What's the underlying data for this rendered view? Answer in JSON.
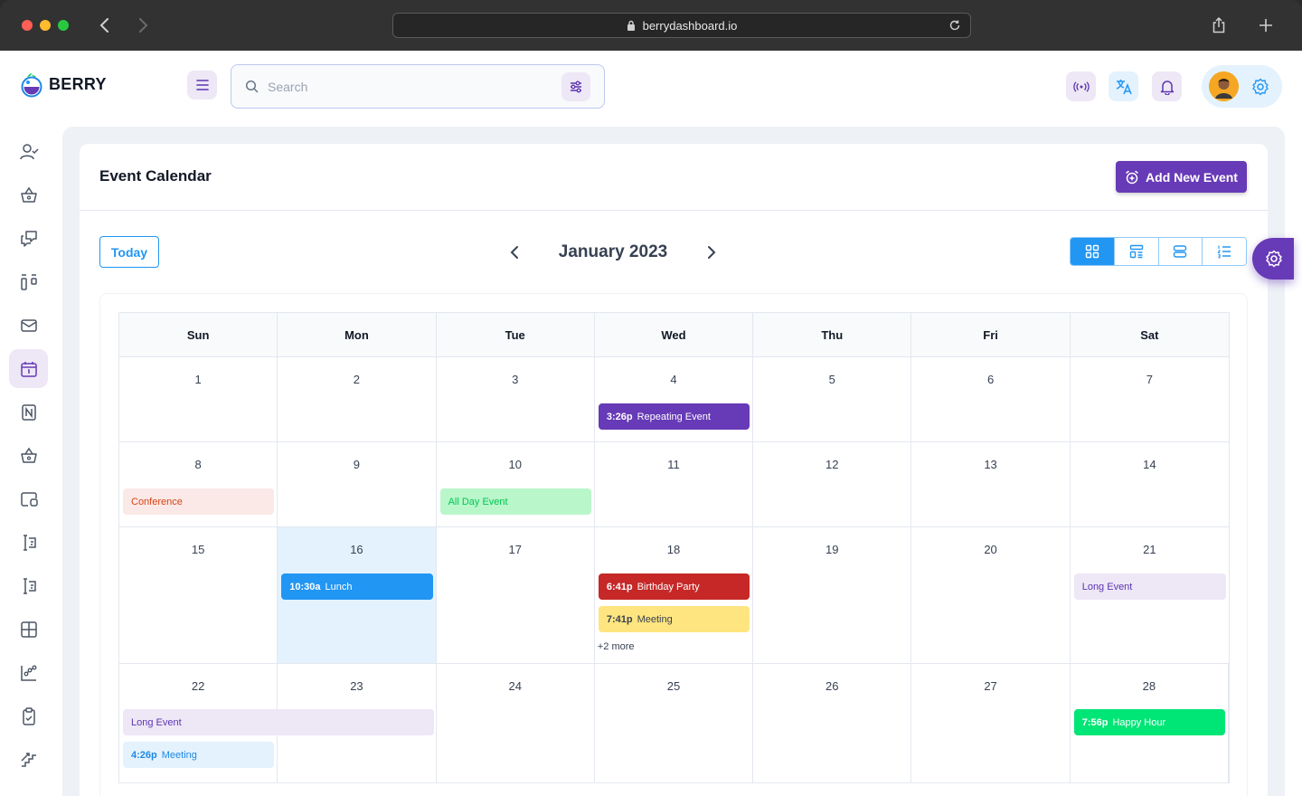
{
  "browser": {
    "url": "berrydashboard.io"
  },
  "brand": {
    "name": "BERRY"
  },
  "search": {
    "placeholder": "Search"
  },
  "page": {
    "title": "Event Calendar",
    "add_button": "Add New Event",
    "today_button": "Today",
    "month_label": "January 2023"
  },
  "colors": {
    "primary": "#673ab7",
    "secondary": "#2196f3",
    "today_bg": "#e3f2fd"
  },
  "calendar": {
    "weekdays": [
      "Sun",
      "Mon",
      "Tue",
      "Wed",
      "Thu",
      "Fri",
      "Sat"
    ],
    "weeks": [
      {
        "days": [
          "1",
          "2",
          "3",
          "4",
          "5",
          "6",
          "7"
        ]
      },
      {
        "days": [
          "8",
          "9",
          "10",
          "11",
          "12",
          "13",
          "14"
        ]
      },
      {
        "days": [
          "15",
          "16",
          "17",
          "18",
          "19",
          "20",
          "21"
        ]
      },
      {
        "days": [
          "22",
          "23",
          "24",
          "25",
          "26",
          "27",
          "28"
        ]
      }
    ],
    "events": {
      "repeating": {
        "time": "3:26p",
        "title": "Repeating Event"
      },
      "conference": {
        "title": "Conference"
      },
      "all_day": {
        "title": "All Day Event"
      },
      "lunch": {
        "time": "10:30a",
        "title": "Lunch"
      },
      "birthday": {
        "time": "6:41p",
        "title": "Birthday Party"
      },
      "meeting": {
        "time": "7:41p",
        "title": "Meeting"
      },
      "more": "+2 more",
      "long_event_a": {
        "title": "Long Event"
      },
      "long_event_b": {
        "title": "Long Event"
      },
      "meeting_2": {
        "time": "4:26p",
        "title": "Meeting"
      },
      "happy_hour": {
        "time": "7:56p",
        "title": "Happy Hour"
      }
    }
  }
}
